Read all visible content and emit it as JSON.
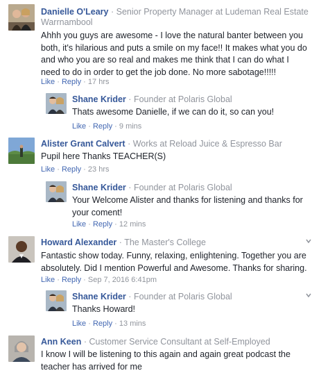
{
  "comments": [
    {
      "name": "Danielle O'Leary",
      "role": "Senior Property Manager at Ludeman Real Estate",
      "role2": "Warrnambool",
      "text": "Ahhh you guys are awesome - I love the natural banter between you both, it's hilarious and puts a smile on my face!! It makes what you do and who you are so real and makes me think that I can do what I need to do in order to get the job done. No more sabotage!!!!!",
      "like": "Like",
      "reply": "Reply",
      "time": "17 hrs"
    },
    {
      "name": "Shane Krider",
      "role": "Founder at Polaris Global",
      "text": "Thats awesome Danielle, if we can do it, so can you!",
      "like": "Like",
      "reply": "Reply",
      "time": "9 mins"
    },
    {
      "name": "Alister Grant Calvert",
      "role": "Works at Reload Juice & Espresso Bar",
      "text": "Pupil here Thanks TEACHER(S)",
      "like": "Like",
      "reply": "Reply",
      "time": "23 hrs"
    },
    {
      "name": "Shane Krider",
      "role": "Founder at Polaris Global",
      "text": "Your Welcome Alister and thanks for listening and thanks for your coment!",
      "like": "Like",
      "reply": "Reply",
      "time": "12 mins"
    },
    {
      "name": "Howard Alexander",
      "role": "The Master's College",
      "text": "Fantastic show today. Funny, relaxing, enlightening. Together you are absolutely. Did I mention Powerful and Awesome. Thanks for sharing.",
      "like": "Like",
      "reply": "Reply",
      "time": "Sep 7, 2016 6:41pm"
    },
    {
      "name": "Shane Krider",
      "role": "Founder at Polaris Global",
      "text": "Thanks Howard!",
      "like": "Like",
      "reply": "Reply",
      "time": "13 mins"
    },
    {
      "name": "Ann Keen",
      "role": "Customer Service Consultant at Self-Employed",
      "text": "I know I will be listening to this again and again great podcast the teacher has arrived for me"
    }
  ],
  "separator_dot": "·",
  "colors": {
    "name": "#365899",
    "link": "#4267b2",
    "muted": "#90949c",
    "text": "#1d2129"
  },
  "icons": [
    "couple-avatar",
    "landscape-avatar",
    "man-avatar",
    "woman-avatar",
    "chevron-down-icon"
  ]
}
